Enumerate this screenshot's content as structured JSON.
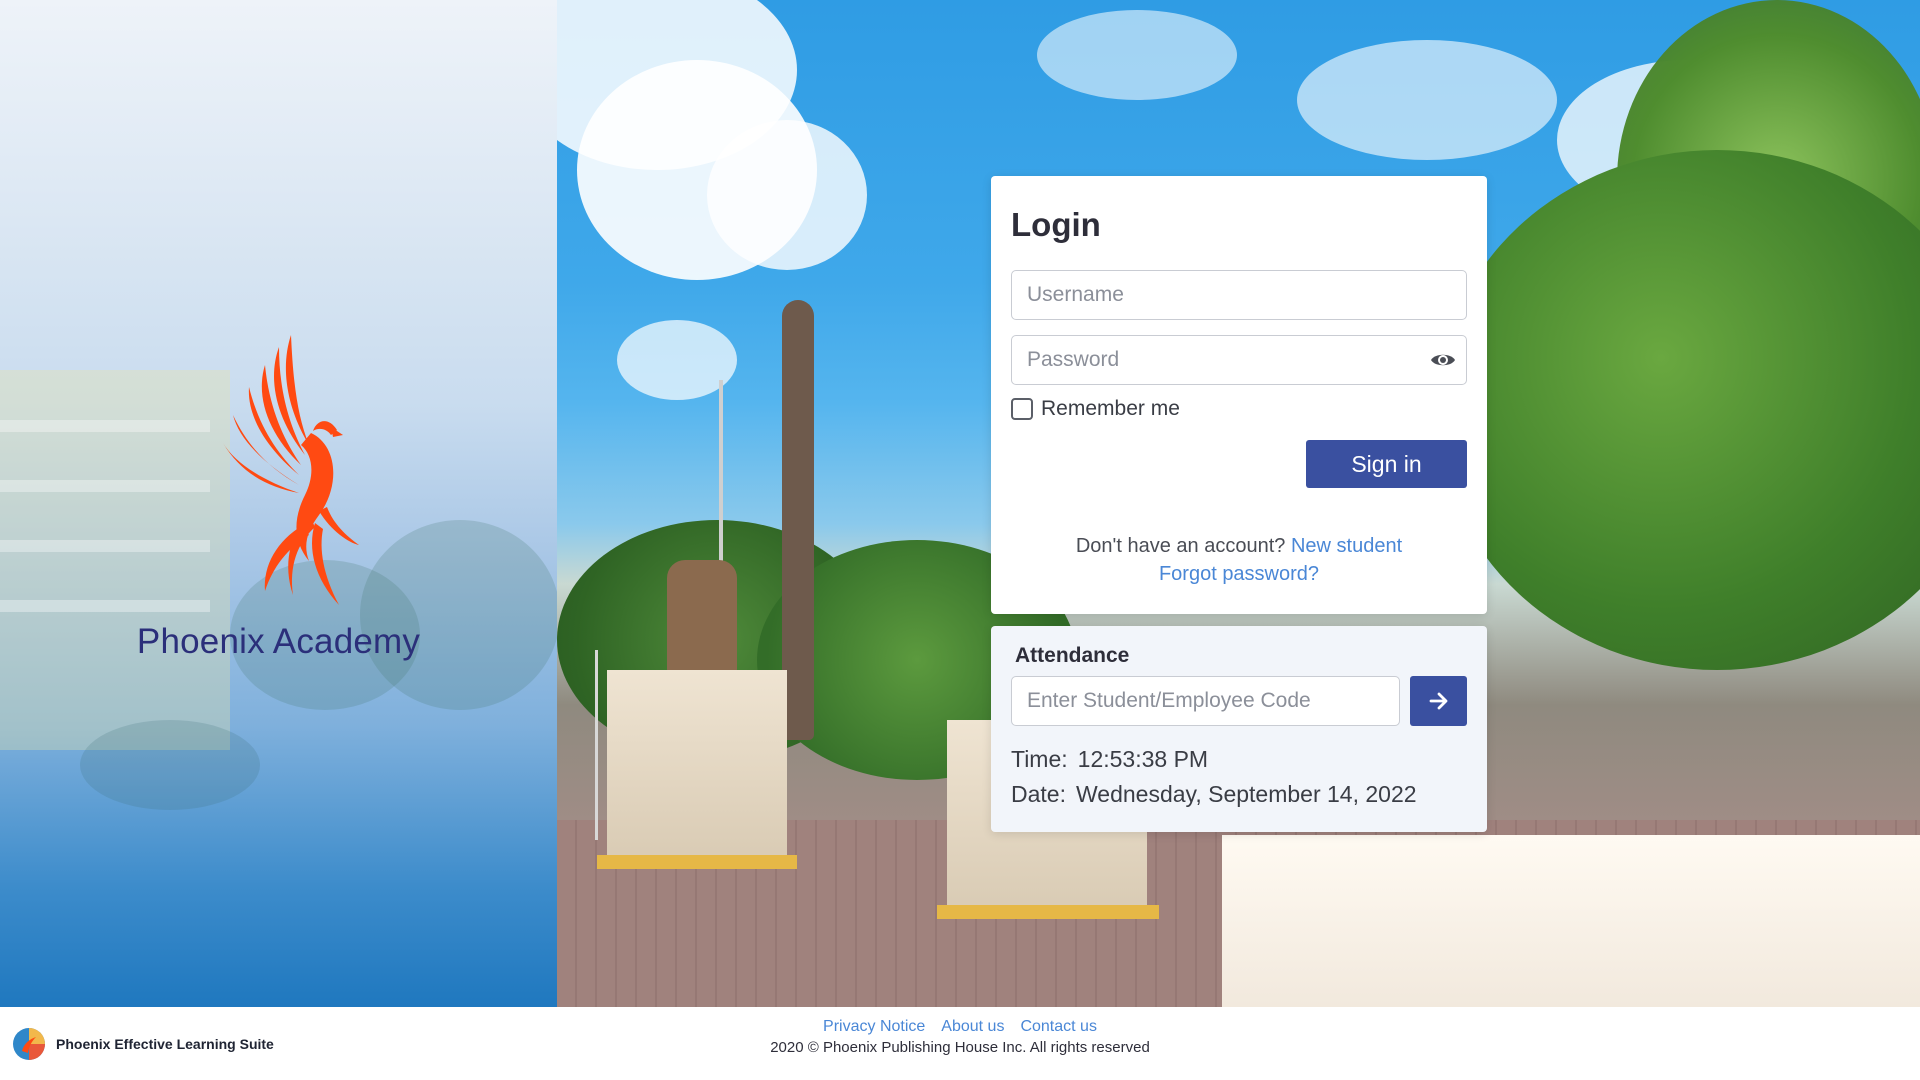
{
  "brand": {
    "name": "Phoenix Academy",
    "logo_icon": "phoenix-bird-icon",
    "logo_color": "#ff4a12",
    "name_color": "#2b2f7a"
  },
  "login": {
    "title": "Login",
    "username_placeholder": "Username",
    "username_value": "",
    "password_placeholder": "Password",
    "password_value": "",
    "show_password_icon": "eye-icon",
    "remember_label": "Remember me",
    "remember_checked": false,
    "signin_label": "Sign in",
    "no_account_text": "Don't have an account?",
    "new_student_link": "New student",
    "forgot_password_link": "Forgot password?"
  },
  "attendance": {
    "title": "Attendance",
    "code_placeholder": "Enter Student/Employee Code",
    "code_value": "",
    "submit_icon": "arrow-right-icon",
    "time_label": "Time:",
    "time_value": "12:53:38 PM",
    "date_label": "Date:",
    "date_value": "Wednesday, September 14, 2022"
  },
  "footer": {
    "suite_name": "Phoenix Effective Learning Suite",
    "links": [
      "Privacy Notice",
      "About us",
      "Contact us"
    ],
    "copyright": "2020 © Phoenix Publishing House Inc. All rights reserved"
  },
  "colors": {
    "primary_button": "#3a50a0",
    "link": "#4a87d6",
    "attendance_bg": "#f2f5fa"
  }
}
